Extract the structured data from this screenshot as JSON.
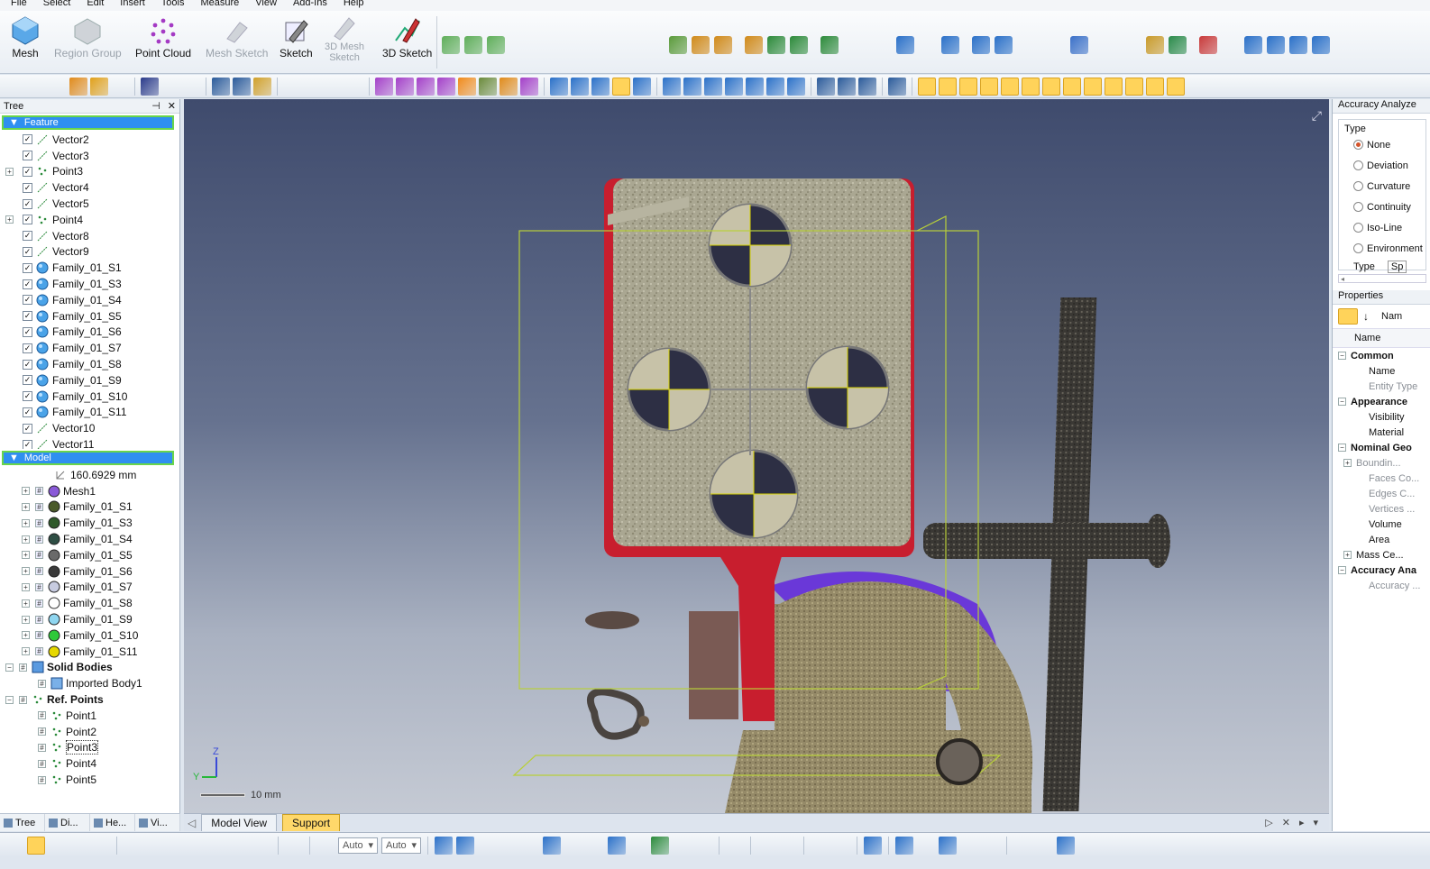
{
  "menu": [
    "File",
    "Select",
    "Edit",
    "Insert",
    "Tools",
    "Measure",
    "View",
    "Add-Ins",
    "Help"
  ],
  "ribbon": {
    "mesh": "Mesh",
    "region_group": "Region Group",
    "point_cloud": "Point Cloud",
    "mesh_sketch": "Mesh Sketch",
    "sketch": "Sketch",
    "mesh3d_1": "3D Mesh",
    "mesh3d_2": "Sketch",
    "sketch3d": "3D Sketch"
  },
  "tree_panel": {
    "title": "Tree",
    "feature_header": "Feature",
    "features": [
      {
        "label": "Vector2",
        "kind": "vector",
        "expand": false
      },
      {
        "label": "Vector3",
        "kind": "vector",
        "expand": false
      },
      {
        "label": "Point3",
        "kind": "point",
        "expand": true
      },
      {
        "label": "Vector4",
        "kind": "vector",
        "expand": false
      },
      {
        "label": "Vector5",
        "kind": "vector",
        "expand": false
      },
      {
        "label": "Point4",
        "kind": "point",
        "expand": true
      },
      {
        "label": "Vector8",
        "kind": "vector",
        "expand": false
      },
      {
        "label": "Vector9",
        "kind": "vector",
        "expand": false
      },
      {
        "label": "Family_01_S1",
        "kind": "sphere",
        "expand": false
      },
      {
        "label": "Family_01_S3",
        "kind": "sphere",
        "expand": false
      },
      {
        "label": "Family_01_S4",
        "kind": "sphere",
        "expand": false
      },
      {
        "label": "Family_01_S5",
        "kind": "sphere",
        "expand": false
      },
      {
        "label": "Family_01_S6",
        "kind": "sphere",
        "expand": false
      },
      {
        "label": "Family_01_S7",
        "kind": "sphere",
        "expand": false
      },
      {
        "label": "Family_01_S8",
        "kind": "sphere",
        "expand": false
      },
      {
        "label": "Family_01_S9",
        "kind": "sphere",
        "expand": false
      },
      {
        "label": "Family_01_S10",
        "kind": "sphere",
        "expand": false
      },
      {
        "label": "Family_01_S11",
        "kind": "sphere",
        "expand": false
      },
      {
        "label": "Vector10",
        "kind": "vector",
        "expand": false
      },
      {
        "label": "Vector11",
        "kind": "vector",
        "expand": false
      }
    ],
    "model_header": "Model",
    "measure": "160.6929 mm",
    "models": [
      {
        "label": "Mesh1",
        "color": "#8a5ad8",
        "ring": false
      },
      {
        "label": "Family_01_S1",
        "color": "#4a5a2a",
        "ring": false
      },
      {
        "label": "Family_01_S3",
        "color": "#2f5a2a",
        "ring": false
      },
      {
        "label": "Family_01_S4",
        "color": "#2e4e44",
        "ring": false
      },
      {
        "label": "Family_01_S5",
        "color": "#6a6a6a",
        "ring": false
      },
      {
        "label": "Family_01_S6",
        "color": "#3a3a3a",
        "ring": false
      },
      {
        "label": "Family_01_S7",
        "color": "#c7cbe0",
        "ring": false
      },
      {
        "label": "Family_01_S8",
        "color": "#ffffff",
        "ring": true
      },
      {
        "label": "Family_01_S9",
        "color": "#8fd6f0",
        "ring": false
      },
      {
        "label": "Family_01_S10",
        "color": "#2ec93a",
        "ring": false
      },
      {
        "label": "Family_01_S11",
        "color": "#e6d800",
        "ring": false
      }
    ],
    "solid_bodies": "Solid Bodies",
    "imported_body": "Imported Body1",
    "ref_points": "Ref. Points",
    "points": [
      "Point1",
      "Point2",
      "Point3",
      "Point4",
      "Point5"
    ],
    "bottom_tabs": [
      "Tree",
      "Di...",
      "He...",
      "Vi..."
    ]
  },
  "viewport": {
    "scale_label": "10 mm",
    "axis_z": "Z",
    "axis_y": "Y",
    "tabs": [
      "Model View",
      "Support"
    ]
  },
  "right_panel": {
    "title": "Accuracy Analyze",
    "type_group": "Type",
    "options": [
      "None",
      "Deviation",
      "Curvature",
      "Continuity",
      "Iso-Line",
      "Environment"
    ],
    "selected": "None",
    "type_label": "Type",
    "type_value": "Sp",
    "properties_title": "Properties",
    "name_col": "Name",
    "name_btn": "Nam",
    "props": [
      {
        "label": "Common",
        "level": 0,
        "group": true
      },
      {
        "label": "Name",
        "level": 1
      },
      {
        "label": "Entity Type",
        "level": 1,
        "dim": true
      },
      {
        "label": "Appearance",
        "level": 0,
        "group": true
      },
      {
        "label": "Visibility",
        "level": 1
      },
      {
        "label": "Material",
        "level": 1
      },
      {
        "label": "Nominal Geo",
        "level": 0,
        "group": true
      },
      {
        "label": "Boundin...",
        "level": 1,
        "dim": true,
        "plus": true
      },
      {
        "label": "Faces Co...",
        "level": 1,
        "dim": true
      },
      {
        "label": "Edges C...",
        "level": 1,
        "dim": true
      },
      {
        "label": "Vertices ...",
        "level": 1,
        "dim": true
      },
      {
        "label": "Volume",
        "level": 1
      },
      {
        "label": "Area",
        "level": 1
      },
      {
        "label": "Mass Ce...",
        "level": 1,
        "plus": true
      },
      {
        "label": "Accuracy Ana",
        "level": 0,
        "group": true
      },
      {
        "label": "Accuracy ...",
        "level": 1,
        "dim": true
      }
    ]
  },
  "status": {
    "combo1": "Auto",
    "combo2": "Auto"
  },
  "colors": {
    "accent": "#2f8ff0",
    "highlight": "#ffd35a",
    "mesh_red": "#c81e2e",
    "mesh_purple": "#6a38d8"
  }
}
